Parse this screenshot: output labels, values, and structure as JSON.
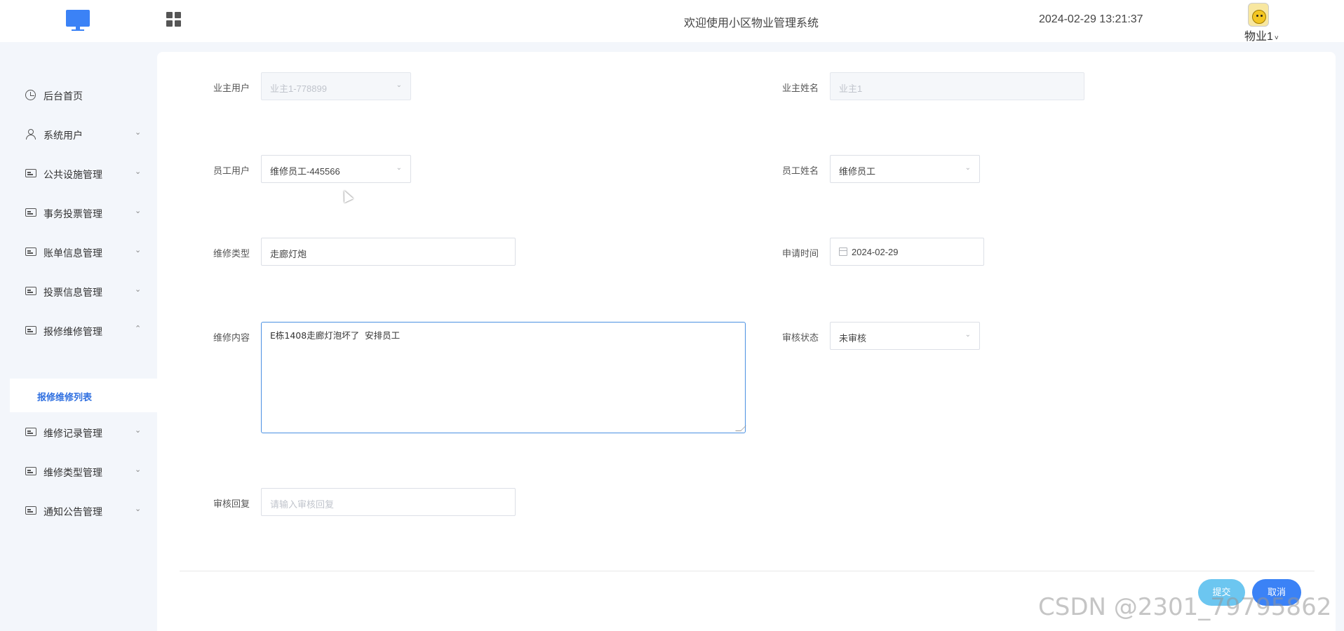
{
  "header": {
    "title": "欢迎使用小区物业管理系统",
    "datetime": "2024-02-29 13:21:37",
    "user_name": "物业1"
  },
  "sidebar": {
    "items": [
      {
        "label": "后台首页",
        "icon": "clock-icon"
      },
      {
        "label": "系统用户",
        "icon": "user-icon"
      },
      {
        "label": "公共设施管理",
        "icon": "card-icon"
      },
      {
        "label": "事务投票管理",
        "icon": "card-icon"
      },
      {
        "label": "账单信息管理",
        "icon": "card-icon"
      },
      {
        "label": "投票信息管理",
        "icon": "card-icon"
      },
      {
        "label": "报修维修管理",
        "icon": "card-icon"
      },
      {
        "label": "维修记录管理",
        "icon": "card-icon"
      },
      {
        "label": "维修类型管理",
        "icon": "card-icon"
      },
      {
        "label": "通知公告管理",
        "icon": "card-icon"
      }
    ],
    "active_submenu": "报修维修列表"
  },
  "form": {
    "owner_user_label": "业主用户",
    "owner_user_value": "业主1-778899",
    "owner_name_label": "业主姓名",
    "owner_name_value": "业主1",
    "staff_user_label": "员工用户",
    "staff_user_value": "维修员工-445566",
    "staff_name_label": "员工姓名",
    "staff_name_value": "维修员工",
    "repair_type_label": "维修类型",
    "repair_type_value": "走廊灯炮",
    "apply_time_label": "申请时间",
    "apply_time_value": "2024-02-29",
    "repair_content_label": "维修内容",
    "repair_content_value": "E栋1408走廊灯泡坏了  安排员工",
    "review_status_label": "审核状态",
    "review_status_value": "未审核",
    "review_reply_label": "审核回复",
    "review_reply_placeholder": "请输入审核回复"
  },
  "buttons": {
    "submit": "提交",
    "cancel": "取消"
  },
  "watermark": "CSDN @2301_79795862",
  "colors": {
    "accent": "#3b82f6",
    "submit": "#6cc6f0",
    "active_text": "#2f6fe0",
    "background": "#f3f6fb"
  }
}
